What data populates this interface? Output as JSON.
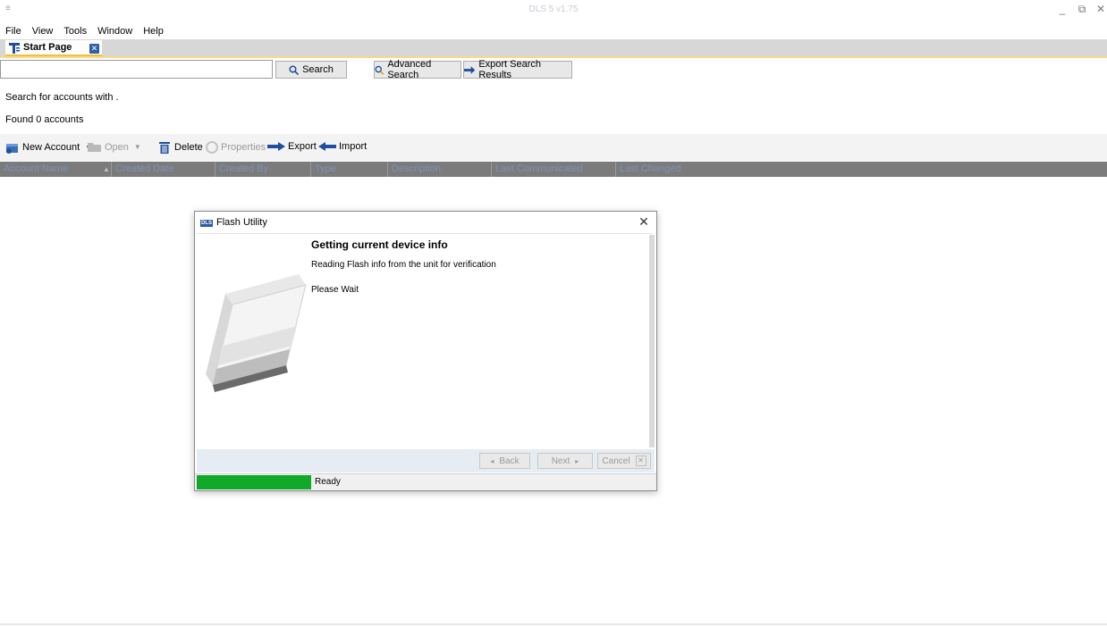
{
  "window": {
    "title": "DLS 5 v1.75",
    "minimize": "_",
    "restore": "⧉",
    "close": "✕"
  },
  "menu": [
    "File",
    "View",
    "Tools",
    "Window",
    "Help"
  ],
  "tab": {
    "label": "Start Page",
    "close": "✕"
  },
  "search": {
    "input_value": "",
    "search_label": "Search",
    "advanced_label": "Advanced Search",
    "export_label": "Export Search Results",
    "summary": "Search for accounts with .",
    "found": "Found 0 accounts"
  },
  "toolbar": {
    "new_account": "New Account",
    "open": "Open",
    "delete": "Delete",
    "properties": "Properties",
    "export": "Export",
    "import": "Import"
  },
  "grid": {
    "columns": [
      "Account Name",
      "Created Date",
      "Created By",
      "Type",
      "Description",
      "Last Communicated",
      "Last Changed"
    ],
    "sort_glyph": "▲"
  },
  "dialog": {
    "title_icon": "DLS",
    "title": "Flash Utility",
    "close": "✕",
    "heading": "Getting current device info",
    "message": "Reading Flash info from the unit for verification",
    "wait": "Please Wait",
    "back": "Back",
    "next": "Next",
    "cancel": "Cancel",
    "status": "Ready",
    "progress": 1.0
  },
  "colors": {
    "progress": "#12a829",
    "header": "#7b7b7b",
    "tab_accent": "#f3c03a"
  }
}
